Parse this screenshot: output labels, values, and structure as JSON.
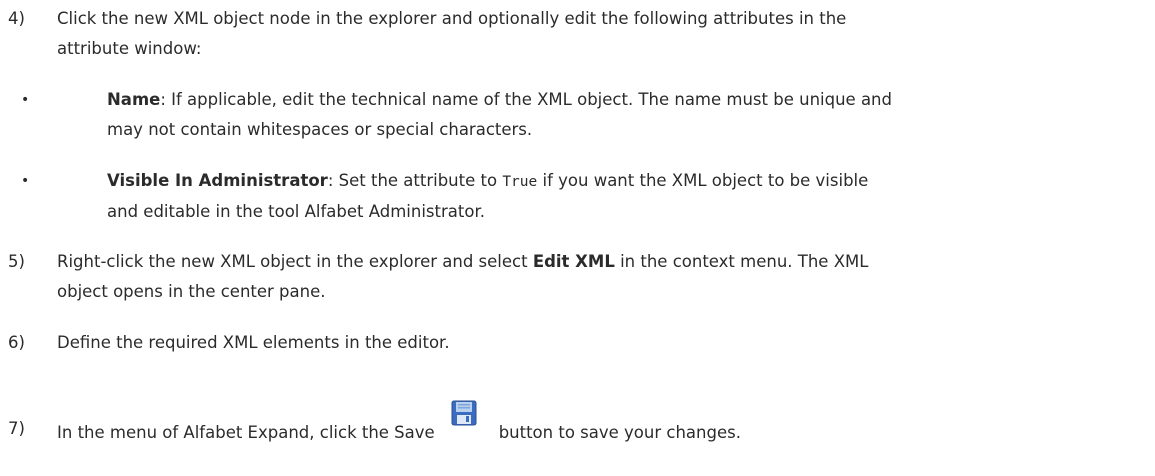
{
  "steps": [
    {
      "number": "4)",
      "text": "Click the new XML object node in the explorer and optionally edit the following attributes in the attribute window:",
      "line1": "Click the new XML object node in the explorer and optionally edit the following attributes in the",
      "line2": "attribute window:"
    },
    {
      "number": "5)",
      "line1_pre": "Right-click the new XML object in the explorer and select ",
      "line1_bold": "Edit XML",
      "line1_post": " in the context menu. The XML",
      "line2": "object opens in the center pane."
    },
    {
      "number": "6)",
      "line1": "Define the required XML elements in the editor."
    },
    {
      "number": "7)",
      "pre": "In the menu of Alfabet Expand, click the Save",
      "post": "button to save your changes."
    }
  ],
  "bullets": [
    {
      "bold": "Name",
      "line1": ": If applicable, edit the technical name of the XML object. The name must be unique and",
      "line2": "may not contain whitespaces or special characters."
    },
    {
      "bold": "Visible In Administrator",
      "line1_pre": ": Set the attribute to ",
      "code": "True",
      "line1_post": " if you want the XML object to be visible",
      "line2": "and editable in the tool Alfabet Administrator."
    }
  ],
  "icons": {
    "bullet": "•",
    "save": "floppy-disk-save-icon"
  },
  "colors": {
    "text": "#2b2b2b",
    "save_icon_blue": "#3a6cc0",
    "save_icon_light": "#b9d0f0"
  }
}
